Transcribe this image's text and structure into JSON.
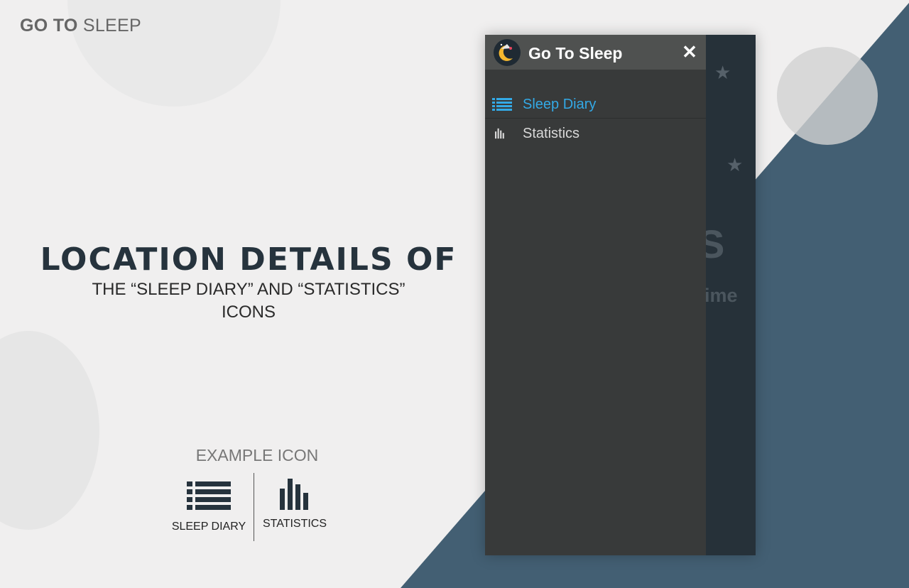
{
  "brand": {
    "bold": "GO TO",
    "light": "SLEEP"
  },
  "headline": {
    "title": "LOCATION DETAILS OF",
    "line1": "THE “SLEEP DIARY” AND “STATISTICS”",
    "line2": "ICONS"
  },
  "example": {
    "title": "EXAMPLE ICON",
    "left_label": "SLEEP DIARY",
    "right_label": "STATISTICS",
    "left_icon": "list-icon",
    "right_icon": "bar-chart-icon"
  },
  "app": {
    "title": "Go To Sleep",
    "close_glyph": "✕",
    "logo_icon": "moon-icon",
    "menu": [
      {
        "label": "Sleep Diary",
        "icon": "list-icon",
        "active": true
      },
      {
        "label": "Statistics",
        "icon": "bar-chart-icon",
        "active": false
      }
    ],
    "background": {
      "big_letter": "S",
      "word": "time"
    }
  },
  "colors": {
    "accent": "#33a9e6",
    "drawer": "#383a3a",
    "drawer_header": "#4f5150",
    "backdrop_blue": "#435f73",
    "heading": "#26333d"
  }
}
